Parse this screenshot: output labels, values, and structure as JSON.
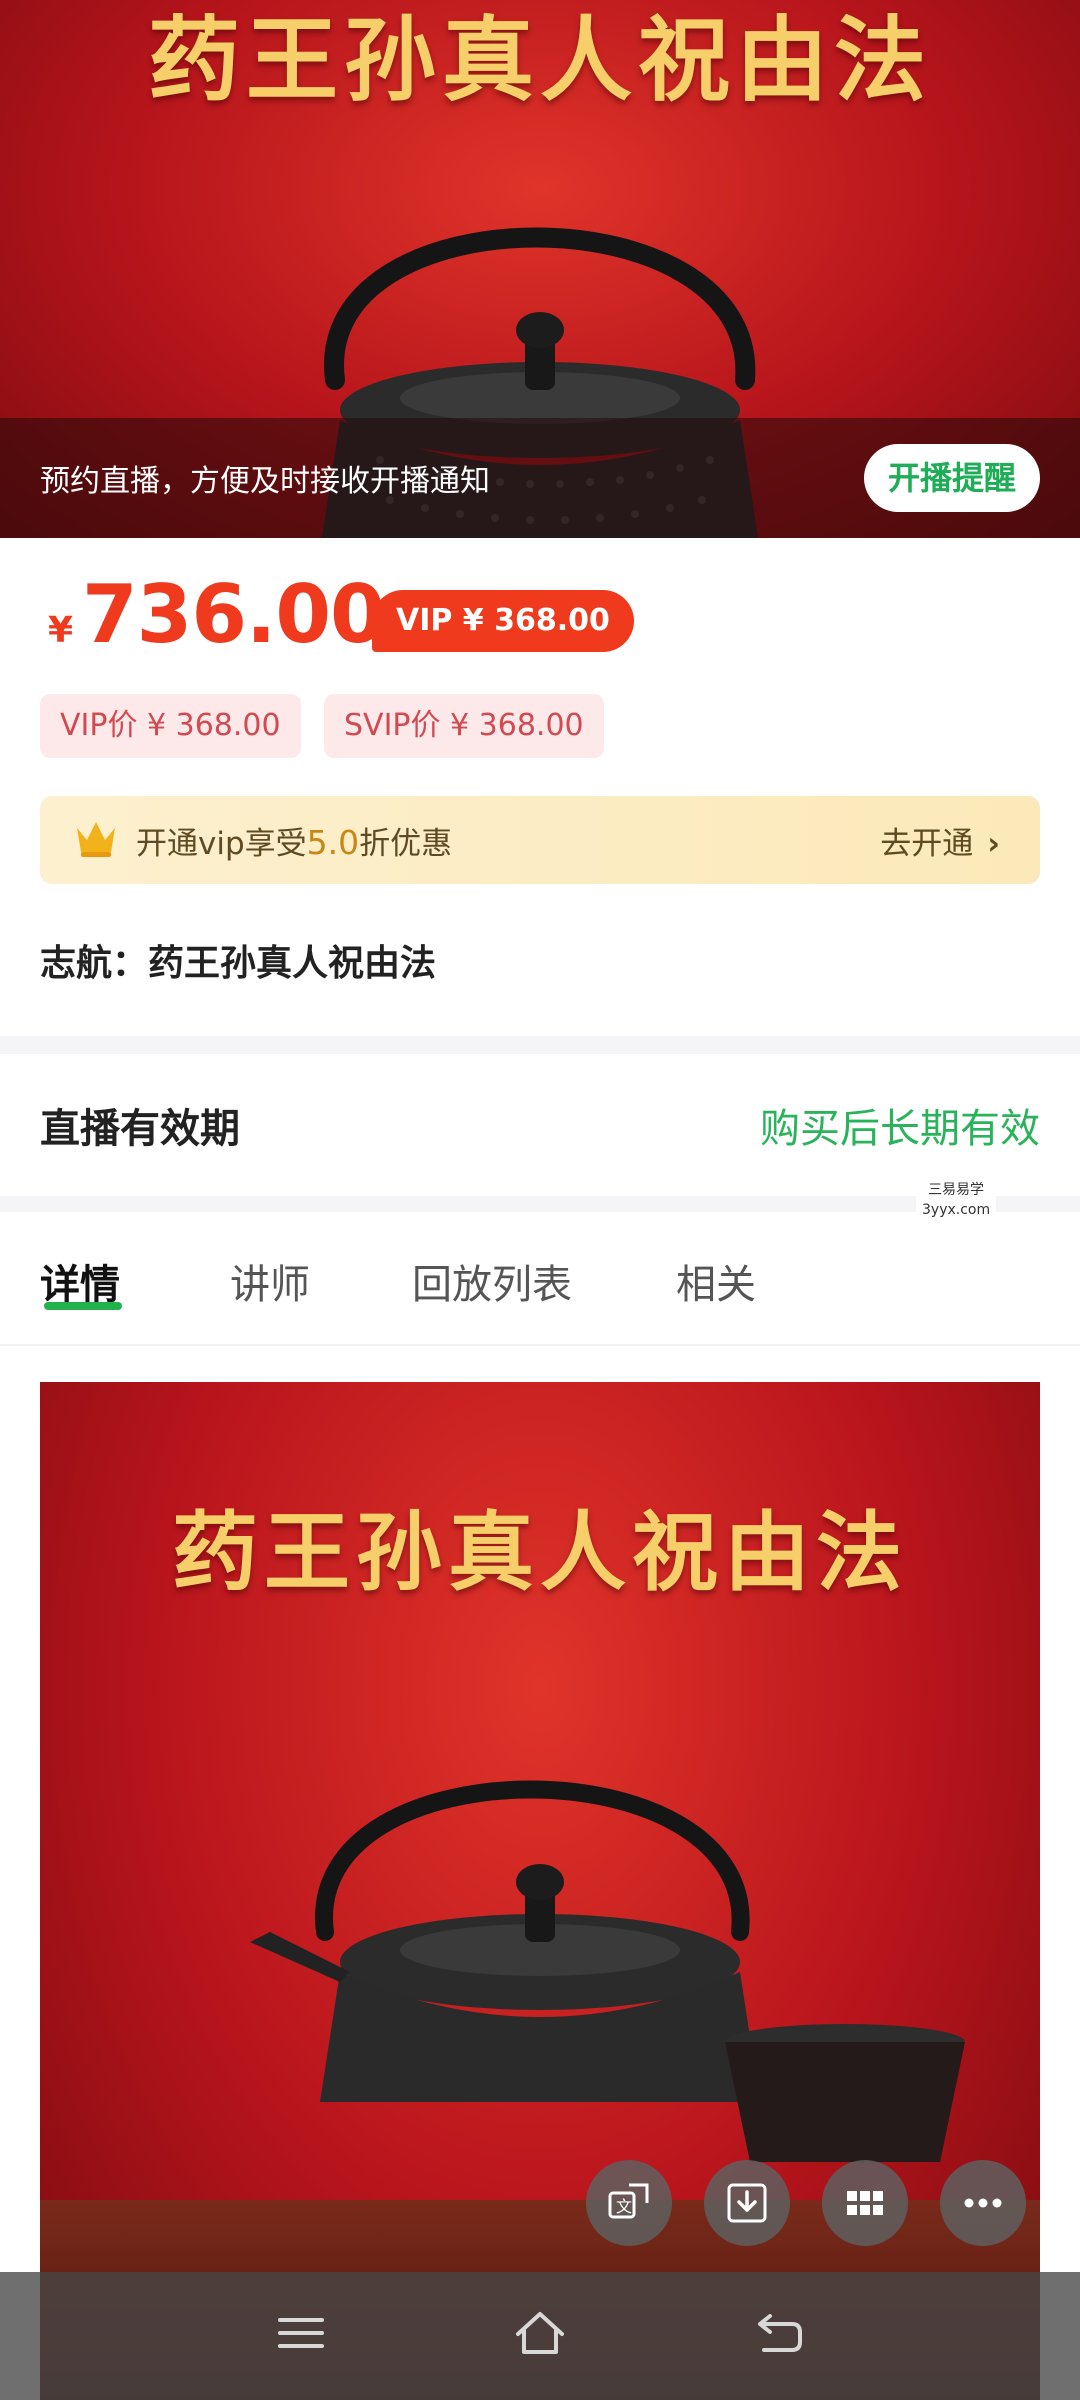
{
  "banner": {
    "title": "药王孙真人祝由法",
    "notice": "预约直播，方便及时接收开播通知",
    "remind_button": "开播提醒"
  },
  "price": {
    "currency_symbol": "¥",
    "amount": "736.00",
    "vip_bubble": "VIP ¥ 368.00",
    "vip_tag": "VIP价 ¥ 368.00",
    "svip_tag": "SVIP价 ¥ 368.00"
  },
  "vip_promo": {
    "prefix": "开通vip享受",
    "discount": "5.0",
    "suffix": "折优惠",
    "action": "去开通",
    "chevron": "›"
  },
  "course": {
    "name": "志航：药王孙真人祝由法"
  },
  "validity": {
    "label": "直播有效期",
    "value": "购买后长期有效"
  },
  "watermark": {
    "line1": "三易易学",
    "line2": "3yyx.com"
  },
  "tabs": [
    {
      "label": "详情",
      "active": true
    },
    {
      "label": "讲师",
      "active": false
    },
    {
      "label": "回放列表",
      "active": false
    },
    {
      "label": "相关",
      "active": false
    }
  ],
  "detail_image": {
    "title": "药王孙真人祝由法"
  },
  "fabs": [
    {
      "icon": "translate-icon"
    },
    {
      "icon": "download-icon"
    },
    {
      "icon": "grid-icon"
    },
    {
      "icon": "more-icon"
    }
  ],
  "system_nav": [
    {
      "icon": "menu-icon"
    },
    {
      "icon": "home-icon"
    },
    {
      "icon": "back-icon"
    }
  ],
  "colors": {
    "price_red": "#ef3a1d",
    "accent_green": "#22b14c",
    "banner_red": "#b5141b",
    "gold_text": "#f6cf6a"
  }
}
